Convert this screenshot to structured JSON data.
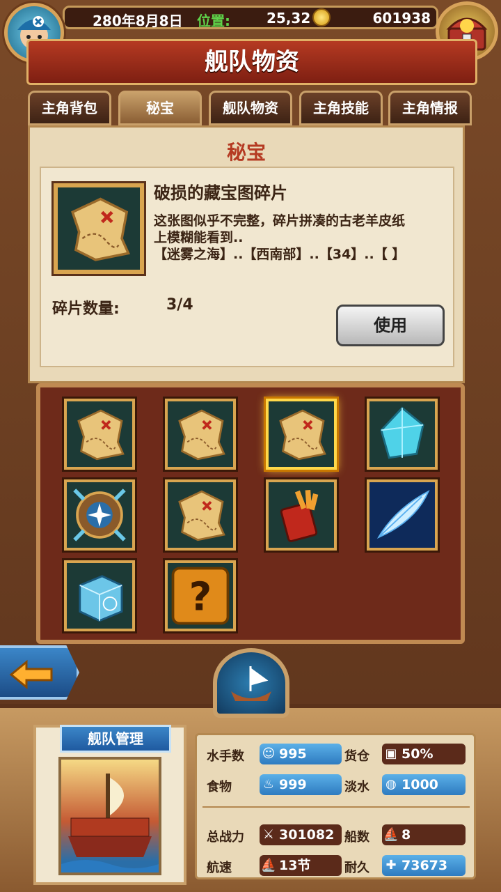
{
  "topbar": {
    "date": "280年8月8日",
    "position_label": "位置:",
    "position_value": "25,32",
    "gold": "601938"
  },
  "header": {
    "title": "舰队物资"
  },
  "tabs": [
    {
      "label": "主角背包",
      "active": false
    },
    {
      "label": "秘宝",
      "active": true
    },
    {
      "label": "舰队物资",
      "active": false
    },
    {
      "label": "主角技能",
      "active": false
    },
    {
      "label": "主角情报",
      "active": false
    }
  ],
  "panel": {
    "title": "秘宝",
    "item_name": "破损的藏宝图碎片",
    "item_desc_1": "这张图似乎不完整，碎片拼凑的古老羊皮纸",
    "item_desc_2": "上模糊能看到..",
    "item_desc_3": "【迷雾之海】..【西南部】..【34】..【 】",
    "fragment_label": "碎片数量:",
    "fragment_count": "3/4",
    "use_button": "使用"
  },
  "inventory": [
    {
      "icon": "treasure-map-fragment",
      "selected": false
    },
    {
      "icon": "treasure-map-fragment",
      "selected": false
    },
    {
      "icon": "treasure-map-fragment",
      "selected": true
    },
    {
      "icon": "blue-crystal-gem",
      "selected": false
    },
    {
      "icon": "compass-shield",
      "selected": false
    },
    {
      "icon": "treasure-map-fragment",
      "selected": false
    },
    {
      "icon": "red-spellbook",
      "selected": false
    },
    {
      "icon": "blue-feather",
      "selected": false
    },
    {
      "icon": "ice-cube",
      "selected": false
    },
    {
      "icon": "mystery-question",
      "selected": false
    }
  ],
  "fleet": {
    "banner": "舰队管理",
    "sailors_label": "水手数",
    "sailors": "995",
    "cargo_label": "货仓",
    "cargo": "50%",
    "food_label": "食物",
    "food": "999",
    "water_label": "淡水",
    "water": "1000",
    "power_label": "总战力",
    "power": "301082",
    "ships_label": "船数",
    "ships": "8",
    "speed_label": "航速",
    "speed": "13节",
    "durability_label": "耐久",
    "durability": "73673"
  }
}
